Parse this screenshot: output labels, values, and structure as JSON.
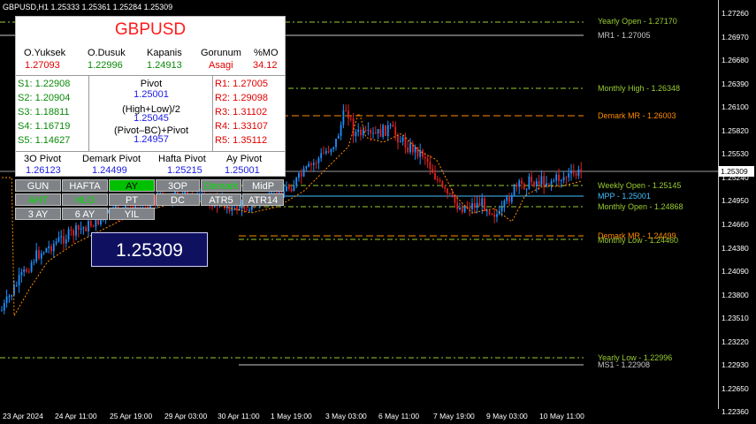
{
  "title": "GBPUSD,H1  1.25333 1.25361 1.25284 1.25309",
  "panel": {
    "symbol": "GBPUSD",
    "headers": [
      "O.Yuksek",
      "O.Dusuk",
      "Kapanis",
      "Gorunum",
      "%MO"
    ],
    "values": [
      "1.27093",
      "1.22996",
      "1.24913",
      "Asagi",
      "34.12"
    ],
    "supports": [
      "S1: 1.22908",
      "S2: 1.20904",
      "S3: 1.18811",
      "S4: 1.16719",
      "S5: 1.14627"
    ],
    "resistances": [
      "R1: 1.27005",
      "R2: 1.29098",
      "R3: 1.31102",
      "R4: 1.33107",
      "R5: 1.35112"
    ],
    "pivot_label": "Pivot",
    "pivot_value": "1.25001",
    "hl2_label": "(High+Low)/2",
    "hl2_value": "1.25045",
    "pbc_label": "(Pivot–BC)+Pivot",
    "pbc_value": "1.24957",
    "bottom_headers": [
      "3O Pivot",
      "Demark Pivot",
      "Hafta Pivot",
      "Ay Pivot"
    ],
    "bottom_values": [
      "1.26123",
      "1.24499",
      "1.25215",
      "1.25001"
    ]
  },
  "buttons": {
    "row1": [
      "GUN",
      "HAFTA",
      "AY",
      "3OP",
      "Demark",
      "MidP"
    ],
    "row2": [
      "AHT",
      "HLO",
      "PT",
      "DC",
      "ATR5",
      "ATR14"
    ],
    "row3": [
      "3 AY",
      "6 AY",
      "YIL"
    ]
  },
  "current_price_box": "1.25309",
  "price_axis": [
    "1.27260",
    "1.26970",
    "1.26680",
    "1.26390",
    "1.26100",
    "1.25820",
    "1.25530",
    "1.25240",
    "1.24950",
    "1.24660",
    "1.24380",
    "1.24090",
    "1.23800",
    "1.23510",
    "1.23220",
    "1.22930",
    "1.22650",
    "1.22360"
  ],
  "current_price_tag": "1.25309",
  "time_axis": [
    "23 Apr 2024",
    "24 Apr 11:00",
    "25 Apr 19:00",
    "29 Apr 03:00",
    "30 Apr 11:00",
    "1 May 19:00",
    "3 May 03:00",
    "6 May 11:00",
    "7 May 19:00",
    "9 May 03:00",
    "10 May 11:00"
  ],
  "levels": [
    {
      "label": "Yearly Open - 1.27170",
      "color": "#9acd32"
    },
    {
      "label": "MR1 - 1.27005",
      "color": "#c8c8c8"
    },
    {
      "label": "Monthly High - 1.26348",
      "color": "#9acd32"
    },
    {
      "label": "Demark MR - 1.26003",
      "color": "#ff8c00"
    },
    {
      "label": "Weekly Open - 1.25145",
      "color": "#9acd32"
    },
    {
      "label": "MPP - 1.25001",
      "color": "#40c0ff"
    },
    {
      "label": "Monthly Open - 1.24868",
      "color": "#9acd32"
    },
    {
      "label": "Demark MR - 1.24499",
      "color": "#ff8c00"
    },
    {
      "label": "Monthly Low - 1.24460",
      "color": "#9acd32"
    },
    {
      "label": "Yearly Low - 1.22996",
      "color": "#9acd32"
    },
    {
      "label": "MS1 - 1.22908",
      "color": "#c8c8c8"
    }
  ],
  "colors": {
    "bull": "#1e90ff",
    "bear": "#e02020",
    "ma": "#ff8c00",
    "panel_title": "#ff1a1a"
  }
}
